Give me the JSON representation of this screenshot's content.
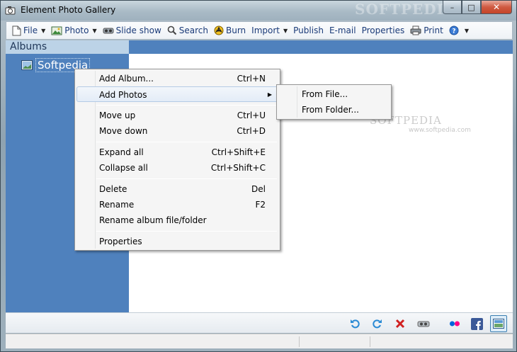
{
  "window": {
    "title": "Element Photo Gallery",
    "watermark": "SOFTPEDIA",
    "buttons": {
      "minimize": "–",
      "maximize": "□",
      "close": "✕"
    }
  },
  "toolbar": {
    "items": [
      {
        "label": "File",
        "icon": "file-icon",
        "dropdown": true
      },
      {
        "label": "Photo",
        "icon": "photo-icon",
        "dropdown": true
      },
      {
        "label": "Slide show",
        "icon": "projector-icon",
        "dropdown": false
      },
      {
        "label": "Search",
        "icon": "magnifier-icon",
        "dropdown": false
      },
      {
        "label": "Burn",
        "icon": "burn-disc-icon",
        "dropdown": false
      },
      {
        "label": "Import",
        "icon": "",
        "dropdown": true
      },
      {
        "label": "Publish",
        "icon": "",
        "dropdown": false
      },
      {
        "label": "E-mail",
        "icon": "",
        "dropdown": false
      },
      {
        "label": "Properties",
        "icon": "",
        "dropdown": false
      },
      {
        "label": "Print",
        "icon": "printer-icon",
        "dropdown": false
      },
      {
        "label": "",
        "icon": "help-icon",
        "dropdown": true
      }
    ]
  },
  "albums": {
    "header": "Albums",
    "nodes": [
      {
        "label": "Softpedia",
        "icon": "album-icon",
        "selected": true
      }
    ]
  },
  "content": {
    "watermark": "SOFTPEDIA",
    "watermark_url": "www.softpedia.com"
  },
  "context_menu": {
    "items": [
      {
        "label": "Add Album...",
        "shortcut": "Ctrl+N"
      },
      {
        "label": "Add Photos",
        "shortcut": "",
        "submenu": true,
        "hot": true
      },
      {
        "label": "Move up",
        "shortcut": "Ctrl+U"
      },
      {
        "label": "Move down",
        "shortcut": "Ctrl+D"
      },
      {
        "label": "Expand all",
        "shortcut": "Ctrl+Shift+E"
      },
      {
        "label": "Collapse all",
        "shortcut": "Ctrl+Shift+C"
      },
      {
        "label": "Delete",
        "shortcut": "Del"
      },
      {
        "label": "Rename",
        "shortcut": "F2"
      },
      {
        "label": "Rename album file/folder",
        "shortcut": ""
      },
      {
        "label": "Properties",
        "shortcut": ""
      }
    ]
  },
  "submenu": {
    "items": [
      {
        "label": "From File..."
      },
      {
        "label": "From Folder..."
      }
    ]
  },
  "bottom_bar": {
    "icons": [
      "rotate-left-icon",
      "rotate-right-icon",
      "delete-icon",
      "slideshow-icon",
      "flickr-icon",
      "facebook-icon",
      "fullscreen-icon"
    ]
  },
  "colors": {
    "albums_bg": "#4f81bd",
    "header_bg": "#bcd3e7",
    "toolbar_text": "#1a3a78",
    "delete_red": "#d02020",
    "facebook_blue": "#3b5998",
    "rotate_blue": "#2a8ad4"
  }
}
